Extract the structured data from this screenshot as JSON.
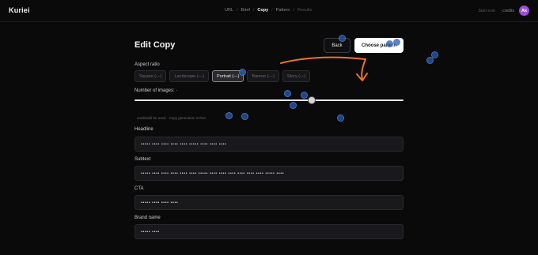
{
  "app": {
    "title": "Kuriei"
  },
  "breadcrumb": {
    "items": [
      "URL",
      "Brief",
      "Copy",
      "Pattern",
      "Results"
    ],
    "active": "Copy"
  },
  "header_right": {
    "start_over": "Start over",
    "credits": "· credits",
    "avatar_initials": "Ak"
  },
  "page": {
    "title": "Edit Copy",
    "back_label": "Back",
    "choose_label": "Choose pattern"
  },
  "aspect": {
    "label": "Aspect ratio",
    "options": [
      "Square (—)",
      "Landscape (—)",
      "Portrait (—)",
      "Banner (—)",
      "Story (—)"
    ],
    "selected": "Portrait (—)"
  },
  "images": {
    "label": "Number of images: ·",
    "value_fraction": 0.66,
    "hint": "· creditswill be used · Copy generation is free"
  },
  "fields": {
    "headline": {
      "label": "Headline",
      "value": "••••• •••• •••• •••• •••• ••••• •••• •••• ••••"
    },
    "subtext": {
      "label": "Subtext",
      "value": "••••• •••• •••• •••• •••• •••• ••••• •••• •••• •••• •••• •••• •••• ••••• ••••"
    },
    "cta": {
      "label": "CTA",
      "value": "••••• •••• •••• ••••"
    },
    "brand": {
      "label": "Brand name",
      "value": "••••• ••••"
    }
  },
  "colors": {
    "background": "#0a0a0b",
    "accent": "#9b4fd6",
    "annotation_arrow": "#e8742a",
    "annotation_dot": "#2a5aa8"
  }
}
